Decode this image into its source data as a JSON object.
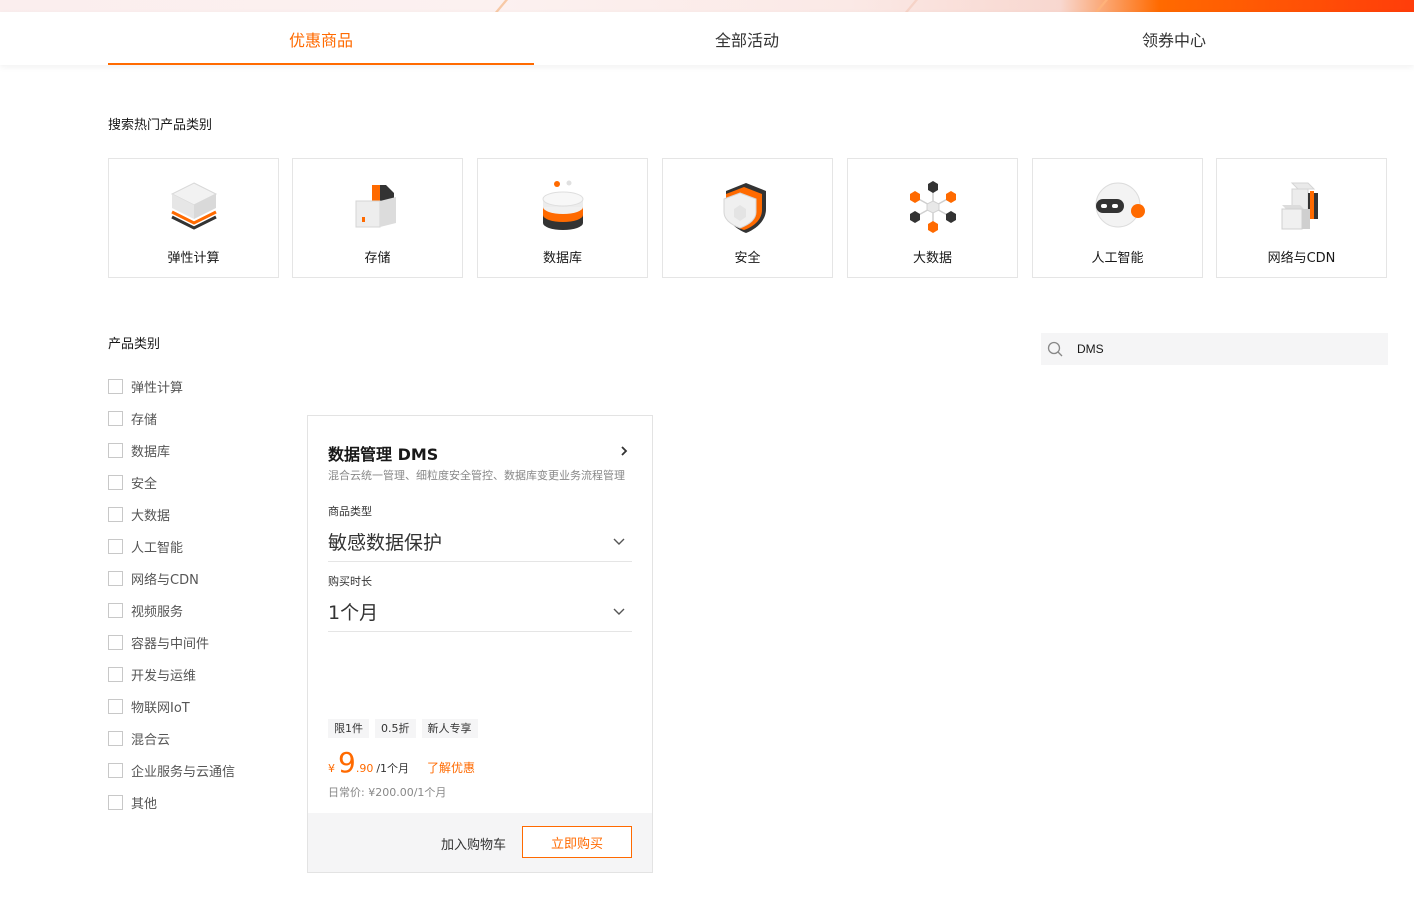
{
  "tabs": [
    {
      "label": "优惠商品",
      "active": true
    },
    {
      "label": "全部活动",
      "active": false
    },
    {
      "label": "领券中心",
      "active": false
    }
  ],
  "hot": {
    "title": "搜索热门产品类别",
    "items": [
      {
        "label": "弹性计算",
        "icon": "server-cube-icon"
      },
      {
        "label": "存储",
        "icon": "storage-box-icon"
      },
      {
        "label": "数据库",
        "icon": "database-stack-icon"
      },
      {
        "label": "安全",
        "icon": "shield-icon"
      },
      {
        "label": "大数据",
        "icon": "hexagon-network-icon"
      },
      {
        "label": "人工智能",
        "icon": "robot-head-icon"
      },
      {
        "label": "网络与CDN",
        "icon": "network-blocks-icon"
      }
    ]
  },
  "filter": {
    "title": "产品类别",
    "items": [
      "弹性计算",
      "存储",
      "数据库",
      "安全",
      "大数据",
      "人工智能",
      "网络与CDN",
      "视频服务",
      "容器与中间件",
      "开发与运维",
      "物联网IoT",
      "混合云",
      "企业服务与云通信",
      "其他"
    ]
  },
  "search": {
    "value": "DMS",
    "icon": "search-icon"
  },
  "product": {
    "title": "数据管理 DMS",
    "desc": "混合云统一管理、细粒度安全管控、数据库变更业务流程管理",
    "type_label": "商品类型",
    "type_value": "敏感数据保护",
    "duration_label": "购买时长",
    "duration_value": "1个月",
    "tags": [
      "限1件",
      "0.5折",
      "新人专享"
    ],
    "price": {
      "currency": "¥",
      "integer": "9",
      "decimal": ".90",
      "unit": "/1个月",
      "more": "了解优惠"
    },
    "original_price": "日常价: ¥200.00/1个月",
    "add_cart": "加入购物车",
    "buy_now": "立即购买"
  },
  "colors": {
    "accent": "#ff6a00",
    "icon_dark": "#333333"
  }
}
